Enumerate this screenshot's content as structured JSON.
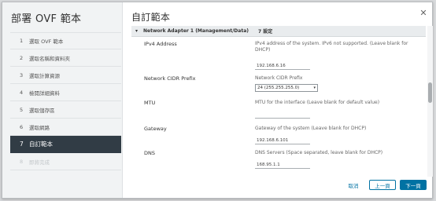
{
  "wizard": {
    "title": "部署 OVF 範本",
    "steps": [
      {
        "num": "1",
        "label": "選取 OVF 範本"
      },
      {
        "num": "2",
        "label": "選取名稱和資料夾"
      },
      {
        "num": "3",
        "label": "選取計算資源"
      },
      {
        "num": "4",
        "label": "檢閱詳細資料"
      },
      {
        "num": "5",
        "label": "選取儲存區"
      },
      {
        "num": "6",
        "label": "選取網路"
      },
      {
        "num": "7",
        "label": "自訂範本"
      },
      {
        "num": "8",
        "label": "即將完成"
      }
    ],
    "active_step": 7
  },
  "content": {
    "title": "自訂範本",
    "section": {
      "title": "Network Adapter 1 (Management/Data)",
      "count": "7 設定"
    },
    "fields": {
      "ipv4": {
        "label": "IPv4 Address",
        "description": "IPv4 address of the system. IPv6 not supported. (Leave blank for DHCP)",
        "value": "192.168.6.16"
      },
      "cidr": {
        "label": "Network CIDR Prefix",
        "description": "Network CIDR Prefix",
        "value": "24 (255.255.255.0)"
      },
      "mtu": {
        "label": "MTU",
        "description": "MTU for the interface (Leave blank for default value)",
        "value": ""
      },
      "gateway": {
        "label": "Gateway",
        "description": "Gateway of the system (Leave blank for DHCP)",
        "value": "192.168.6.101"
      },
      "dns": {
        "label": "DNS",
        "description": "DNS Servers (Space separated, leave blank for DHCP)",
        "value": "168.95.1.1"
      }
    }
  },
  "footer": {
    "cancel": "取消",
    "back": "上一頁",
    "next": "下一頁"
  },
  "icons": {
    "close": "close-icon",
    "chevron": "chevron-down-icon"
  },
  "colors": {
    "accent": "#0072a3",
    "active_step_bg": "#313c45"
  }
}
